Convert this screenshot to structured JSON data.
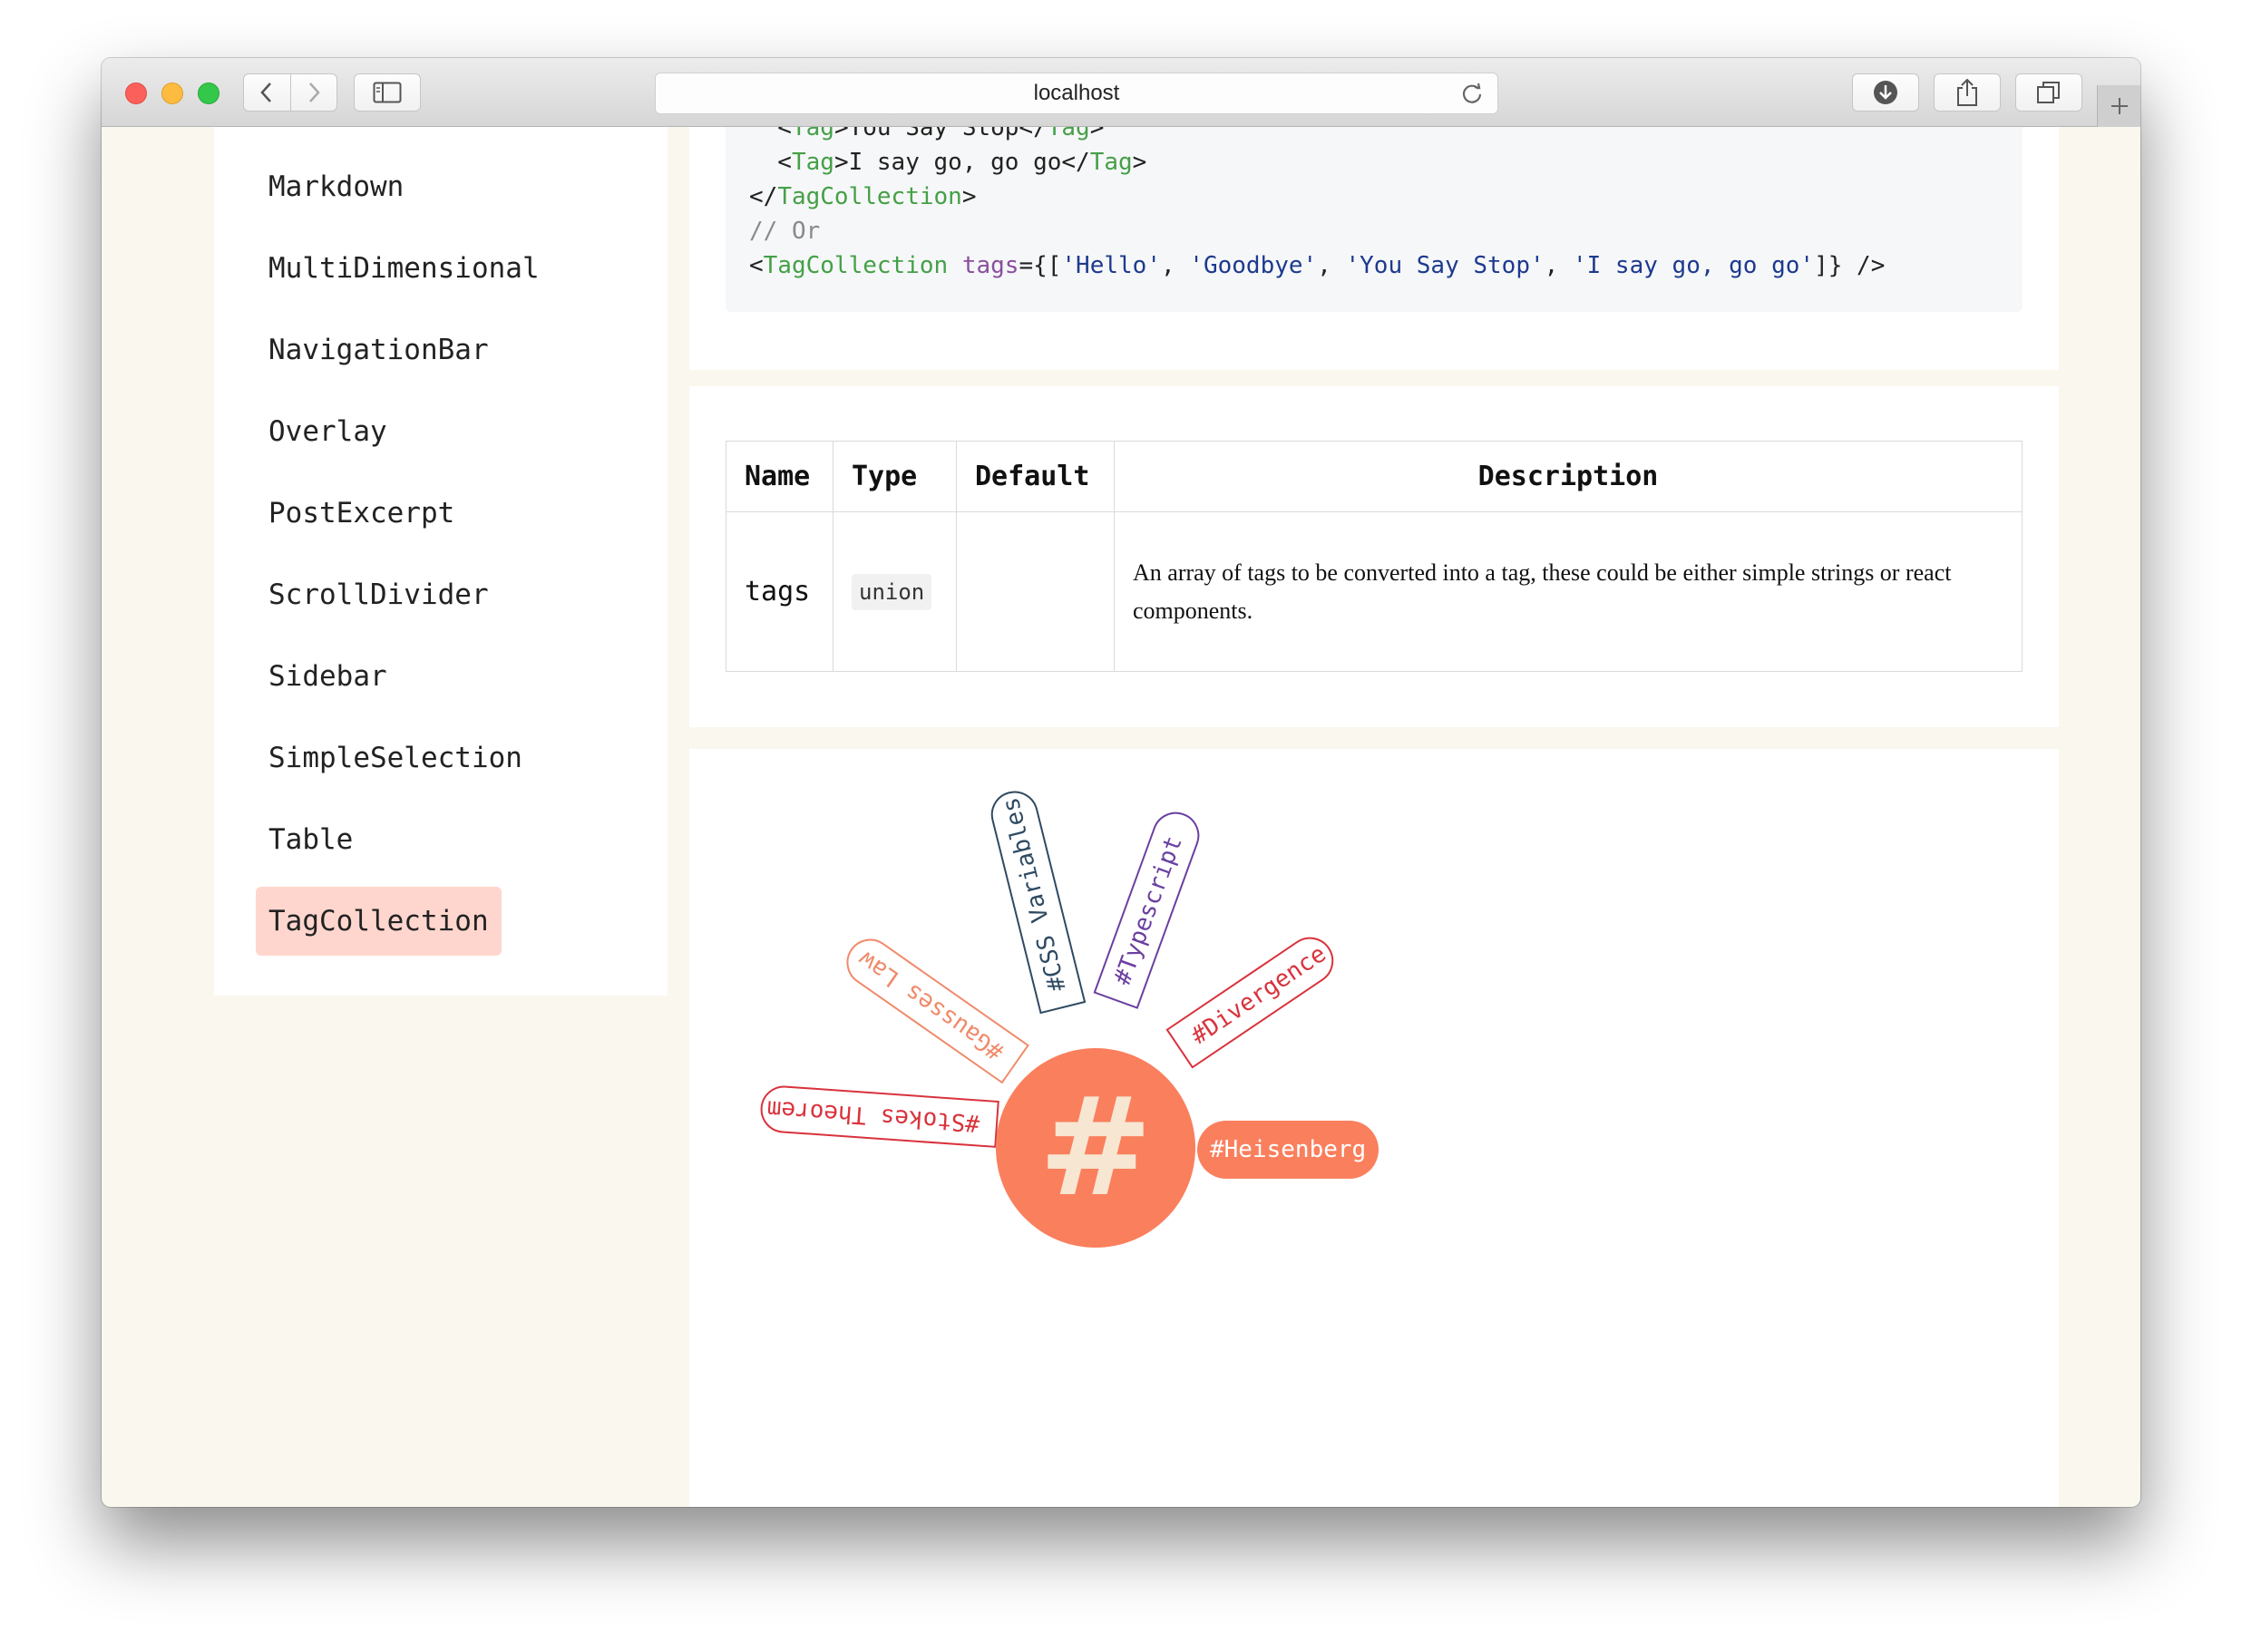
{
  "browser": {
    "address": "localhost",
    "icons": [
      "back-icon",
      "forward-icon",
      "sidebar-icon",
      "reload-icon",
      "download-icon",
      "share-icon",
      "tabs-icon",
      "new-tab-icon"
    ]
  },
  "sidebar": {
    "items": [
      {
        "label": "Markdown"
      },
      {
        "label": "MultiDimensional"
      },
      {
        "label": "NavigationBar"
      },
      {
        "label": "Overlay"
      },
      {
        "label": "PostExcerpt"
      },
      {
        "label": "ScrollDivider"
      },
      {
        "label": "Sidebar"
      },
      {
        "label": "SimpleSelection"
      },
      {
        "label": "Table"
      },
      {
        "label": "TagCollection",
        "active": true
      }
    ]
  },
  "code": {
    "lines": [
      "  <Tag>You Say Stop</Tag>",
      "  <Tag>I say go, go go</Tag>",
      "</TagCollection>",
      "// Or",
      "<TagCollection tags={['Hello', 'Goodbye', 'You Say Stop', 'I say go, go go']} />"
    ]
  },
  "props_table": {
    "headers": [
      "Name",
      "Type",
      "Default",
      "Description"
    ],
    "rows": [
      {
        "name": "tags",
        "type": "union",
        "default": "",
        "description": "An array of tags to be converted into a tag, these could be either simple strings or react components."
      }
    ]
  },
  "demo": {
    "center_symbol": "#",
    "tags": [
      {
        "label": "#Stokes Theorem",
        "color": "#d9323c"
      },
      {
        "label": "#Gausses Law",
        "color": "#f08a6a"
      },
      {
        "label": "#CSS Variables",
        "color": "#2e4a62"
      },
      {
        "label": "#Typescript",
        "color": "#6a3fa0"
      },
      {
        "label": "#Divergence",
        "color": "#d9323c"
      },
      {
        "label": "#Heisenberg",
        "color": "#fa7f5d",
        "filled": true
      }
    ]
  },
  "colors": {
    "accent": "#fa7f5d",
    "active_nav_bg": "#ffd6ce",
    "page_bg": "#faf7ef"
  }
}
